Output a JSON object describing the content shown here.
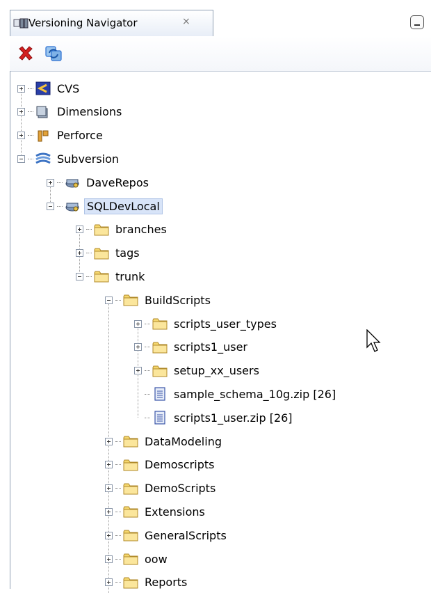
{
  "tab": {
    "title": "Versioning Navigator",
    "close": "×"
  },
  "toolbar": {
    "delete_icon": "red-x-icon",
    "refresh_icon": "refresh-icon"
  },
  "tree": [
    {
      "label": "CVS",
      "icon": "cvs-icon",
      "expander": "plus"
    },
    {
      "label": "Dimensions",
      "icon": "dimensions-icon",
      "expander": "plus"
    },
    {
      "label": "Perforce",
      "icon": "perforce-icon",
      "expander": "plus"
    },
    {
      "label": "Subversion",
      "icon": "subversion-icon",
      "expander": "minus"
    },
    {
      "label": "DaveRepos",
      "icon": "repository-icon",
      "expander": "plus"
    },
    {
      "label": "SQLDevLocal",
      "icon": "repository-icon",
      "expander": "minus",
      "selected": true
    },
    {
      "label": "branches",
      "icon": "folder-icon",
      "expander": "plus"
    },
    {
      "label": "tags",
      "icon": "folder-icon",
      "expander": "plus"
    },
    {
      "label": "trunk",
      "icon": "folder-icon",
      "expander": "minus"
    },
    {
      "label": "BuildScripts",
      "icon": "folder-icon",
      "expander": "minus"
    },
    {
      "label": "scripts_user_types",
      "icon": "folder-icon",
      "expander": "plus"
    },
    {
      "label": "scripts1_user",
      "icon": "folder-icon",
      "expander": "plus"
    },
    {
      "label": "setup_xx_users",
      "icon": "folder-icon",
      "expander": "plus"
    },
    {
      "label": "sample_schema_10g.zip [26]",
      "icon": "file-icon",
      "expander": "none"
    },
    {
      "label": "scripts1_user.zip [26]",
      "icon": "file-icon",
      "expander": "none"
    },
    {
      "label": "DataModeling",
      "icon": "folder-icon",
      "expander": "plus"
    },
    {
      "label": "Demoscripts",
      "icon": "folder-icon",
      "expander": "plus"
    },
    {
      "label": "DemoScripts",
      "icon": "folder-icon",
      "expander": "plus"
    },
    {
      "label": "Extensions",
      "icon": "folder-icon",
      "expander": "plus"
    },
    {
      "label": "GeneralScripts",
      "icon": "folder-icon",
      "expander": "plus"
    },
    {
      "label": "oow",
      "icon": "folder-icon",
      "expander": "plus"
    },
    {
      "label": "Reports",
      "icon": "folder-icon",
      "expander": "plus"
    }
  ],
  "colors": {
    "folder": "#f5d76e",
    "selection": "#d8e4f8",
    "delete": "#d42020",
    "accent": "#2a6fd1"
  }
}
